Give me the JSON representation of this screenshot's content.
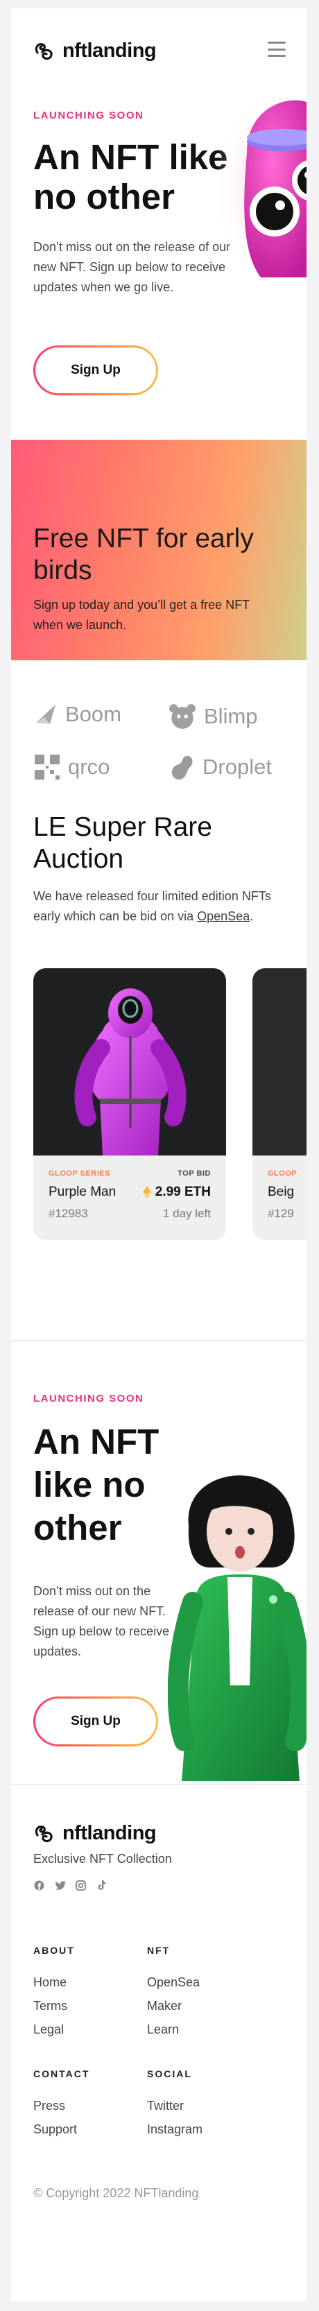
{
  "header": {
    "brand": "nftlanding",
    "menu_icon": "hamburger-icon"
  },
  "hero": {
    "eyebrow": "LAUNCHING SOON",
    "title": "An NFT like no other",
    "description": "Don’t miss out on the release of our new NFT. Sign up below to receive updates when we go live.",
    "cta": "Sign Up"
  },
  "banner": {
    "title": "Free NFT for early birds",
    "text": "Sign up today and you’ll get a free NFT when we launch."
  },
  "partners": [
    {
      "name": "Boom",
      "icon": "boom-icon"
    },
    {
      "name": "Blimp",
      "icon": "blimp-icon"
    },
    {
      "name": "qrco",
      "icon": "qrco-icon"
    },
    {
      "name": "Droplet",
      "icon": "droplet-icon"
    }
  ],
  "auction": {
    "title": "LE Super Rare Auction",
    "text_prefix": "We have released four limited edition NFTs early which can be bid on via ",
    "link": "OpenSea",
    "text_suffix": ".",
    "cards": [
      {
        "series": "GLOOP SERIES",
        "top_bid_label": "TOP BID",
        "name": "Purple Man",
        "price": "2.99 ETH",
        "id": "#12983",
        "time_left": "1 day left"
      },
      {
        "series": "GLOOP",
        "top_bid_label": "",
        "name": "Beig",
        "price": "",
        "id": "#129",
        "time_left": ""
      }
    ]
  },
  "hero2": {
    "eyebrow": "LAUNCHING SOON",
    "title": "An NFT like no other",
    "description": "Don’t miss out on the release of our new NFT. Sign up below to receive updates.",
    "cta": "Sign Up"
  },
  "footer": {
    "brand": "nftlanding",
    "tagline": "Exclusive NFT Collection",
    "social_icons": [
      "facebook-icon",
      "twitter-icon",
      "instagram-icon",
      "tiktok-icon"
    ],
    "columns": [
      {
        "heading": "ABOUT",
        "links": [
          "Home",
          "Terms",
          "Legal"
        ]
      },
      {
        "heading": "NFT",
        "links": [
          "OpenSea",
          "Maker",
          "Learn"
        ]
      },
      {
        "heading": "CONTACT",
        "links": [
          "Press",
          "Support"
        ]
      },
      {
        "heading": "SOCIAL",
        "links": [
          "Twitter",
          "Instagram"
        ]
      }
    ],
    "copyright": "© Copyright 2022 NFTlanding"
  },
  "colors": {
    "accent_pink": "#e6337a",
    "accent_orange": "#ff7a45",
    "eth_gold": "#f7b731"
  }
}
